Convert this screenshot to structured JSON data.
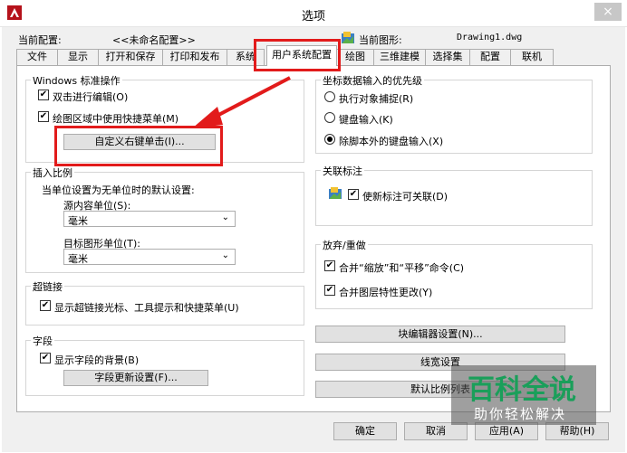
{
  "window": {
    "title": "选项",
    "close_glyph": "×"
  },
  "header": {
    "current_profile_label": "当前配置:",
    "current_profile_value": "<<未命名配置>>",
    "current_drawing_label": "当前图形:",
    "current_drawing_value": "Drawing1.dwg"
  },
  "tabs": [
    {
      "label": "文件"
    },
    {
      "label": "显示"
    },
    {
      "label": "打开和保存"
    },
    {
      "label": "打印和发布"
    },
    {
      "label": "系统"
    },
    {
      "label": "用户系统配置"
    },
    {
      "label": "绘图"
    },
    {
      "label": "三维建模"
    },
    {
      "label": "选择集"
    },
    {
      "label": "配置"
    },
    {
      "label": "联机"
    }
  ],
  "windows_ops": {
    "title": "Windows 标准操作",
    "dbl_click_edit": "双击进行编辑(O)",
    "shortcut_menu": "绘图区域中使用快捷菜单(M)",
    "right_click_button": "自定义右键单击(I)..."
  },
  "insert_scale": {
    "title": "插入比例",
    "desc": "当单位设置为无单位时的默认设置:",
    "source_label": "源内容单位(S):",
    "source_value": "毫米",
    "target_label": "目标图形单位(T):",
    "target_value": "毫米"
  },
  "hyperlink": {
    "title": "超链接",
    "option": "显示超链接光标、工具提示和快捷菜单(U)"
  },
  "fields": {
    "title": "字段",
    "option": "显示字段的背景(B)",
    "button": "字段更新设置(F)..."
  },
  "coord_priority": {
    "title": "坐标数据输入的优先级",
    "opt1": "执行对象捕捉(R)",
    "opt2": "键盘输入(K)",
    "opt3": "除脚本外的键盘输入(X)"
  },
  "assoc_dim": {
    "title": "关联标注",
    "option": "使新标注可关联(D)"
  },
  "undo_redo": {
    "title": "放弃/重做",
    "opt1": "合并“缩放”和“平移”命令(C)",
    "opt2": "合并图层特性更改(Y)"
  },
  "right_buttons": {
    "block_editor": "块编辑器设置(N)...",
    "lineweight": "线宽设置",
    "default_scale": "默认比例列表"
  },
  "bottom_buttons": {
    "ok": "确定",
    "cancel": "取消",
    "apply": "应用(A)",
    "help": "帮助(H)"
  },
  "watermark": {
    "title": "百科全说",
    "subtitle": "助你轻松解决"
  },
  "colors": {
    "annotation_red": "#e21b1b",
    "watermark_green": "#1a9f5a"
  }
}
